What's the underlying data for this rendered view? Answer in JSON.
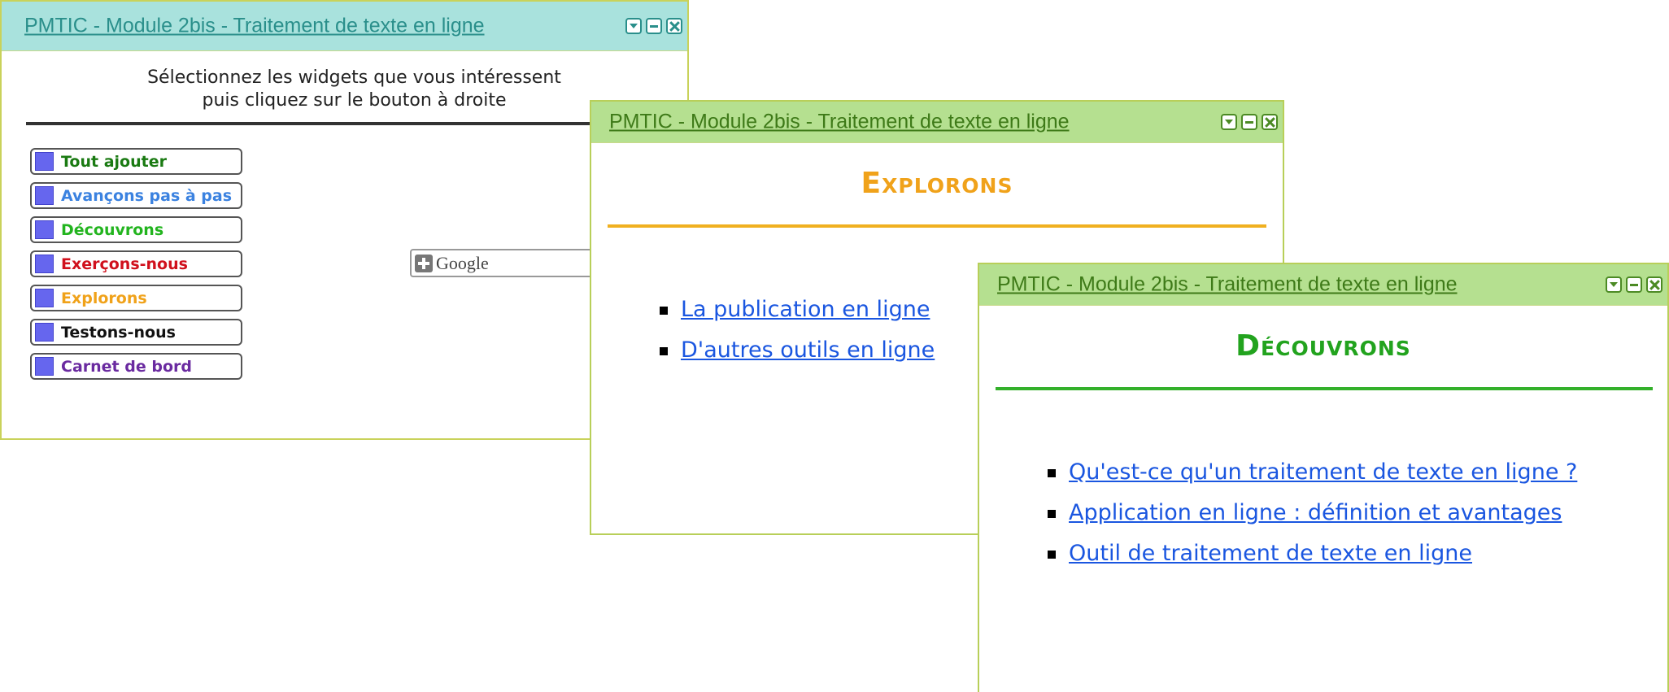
{
  "selector_widget": {
    "title": "PMTIC - Module 2bis - Traitement de texte en ligne",
    "instructions_line1": "Sélectionnez les widgets que vous intéressent",
    "instructions_line2": "puis cliquez sur le bouton à droite",
    "items": [
      {
        "label": "Tout ajouter",
        "color": "#1a7a12"
      },
      {
        "label": "Avançons pas à pas",
        "color": "#3b82e0"
      },
      {
        "label": "Découvrons",
        "color": "#22b41e"
      },
      {
        "label": "Exerçons-nous",
        "color": "#d0101c"
      },
      {
        "label": "Explorons",
        "color": "#f0a21a"
      },
      {
        "label": "Testons-nous",
        "color": "#111111"
      },
      {
        "label": "Carnet de bord",
        "color": "#6a2aa0"
      }
    ],
    "google_button_label": "Google"
  },
  "explorons_widget": {
    "title": "PMTIC - Module 2bis - Traitement de texte en ligne",
    "heading": "Explorons",
    "links": [
      "La publication en ligne",
      "D'autres outils en ligne"
    ]
  },
  "decouvrons_widget": {
    "title": "PMTIC - Module 2bis - Traitement de texte en ligne",
    "heading": "Découvrons",
    "links": [
      "Qu'est-ce qu'un traitement de texte en ligne ?",
      "Application en ligne : définition et avantages",
      "Outil de traitement de texte en ligne"
    ]
  },
  "icons": {
    "menu": "chevron-down-icon",
    "minimize": "minimize-icon",
    "close": "close-icon",
    "checkbox": "checkbox-icon",
    "add": "plus-icon",
    "bullet": "bullet-icon"
  }
}
